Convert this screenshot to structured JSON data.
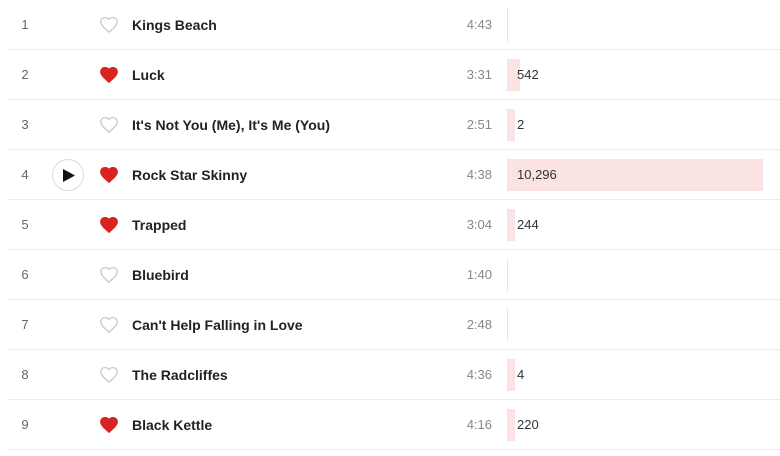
{
  "colors": {
    "heart_loved": "#d92323",
    "heart_empty": "#cccccc",
    "bar": "#fbe3e3"
  },
  "max_scrobbles": 10296,
  "tracks": [
    {
      "number": "1",
      "title": "Kings Beach",
      "duration": "4:43",
      "loved": false,
      "scrobbles": null,
      "scrobbles_label": ""
    },
    {
      "number": "2",
      "title": "Luck",
      "duration": "3:31",
      "loved": true,
      "scrobbles": 542,
      "scrobbles_label": "542"
    },
    {
      "number": "3",
      "title": "It's Not You (Me), It's Me (You)",
      "duration": "2:51",
      "loved": false,
      "scrobbles": 2,
      "scrobbles_label": "2"
    },
    {
      "number": "4",
      "title": "Rock Star Skinny",
      "duration": "4:38",
      "loved": true,
      "scrobbles": 10296,
      "scrobbles_label": "10,296",
      "play_button": true
    },
    {
      "number": "5",
      "title": "Trapped",
      "duration": "3:04",
      "loved": true,
      "scrobbles": 244,
      "scrobbles_label": "244"
    },
    {
      "number": "6",
      "title": "Bluebird",
      "duration": "1:40",
      "loved": false,
      "scrobbles": null,
      "scrobbles_label": ""
    },
    {
      "number": "7",
      "title": "Can't Help Falling in Love",
      "duration": "2:48",
      "loved": false,
      "scrobbles": null,
      "scrobbles_label": ""
    },
    {
      "number": "8",
      "title": "The Radcliffes",
      "duration": "4:36",
      "loved": false,
      "scrobbles": 4,
      "scrobbles_label": "4"
    },
    {
      "number": "9",
      "title": "Black Kettle",
      "duration": "4:16",
      "loved": true,
      "scrobbles": 220,
      "scrobbles_label": "220"
    }
  ]
}
